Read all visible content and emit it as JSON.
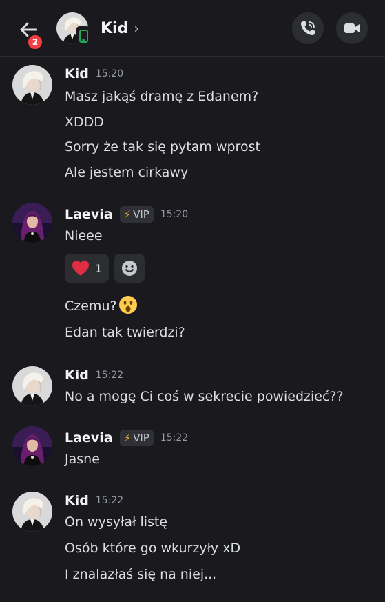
{
  "header": {
    "back_badge": "2",
    "title": "Kid",
    "chevron": "›",
    "icons": {
      "back": "arrow-left-icon",
      "call": "phone-call-icon",
      "video": "video-camera-icon",
      "status": "mobile-online-icon"
    }
  },
  "colors": {
    "background": "#1a1a1e",
    "badge": "#f23f43",
    "online": "#23a55a",
    "bolt": "#f0b232",
    "heart": "#dd2e44"
  },
  "messages": [
    {
      "author": "Kid",
      "time": "15:20",
      "lines": [
        "Masz jakąś dramę z Edanem?",
        "XDDD",
        "Sorry że tak się pytam wprost",
        "Ale jestem cirkawy"
      ]
    },
    {
      "author": "Laevia",
      "badge": "VIP",
      "time": "15:20",
      "lines": [
        "Nieee"
      ],
      "reactions": [
        {
          "emoji": "heart-emoji",
          "count": "1"
        }
      ],
      "followup": [
        "Czemu?",
        "Edan tak twierdzi?"
      ]
    },
    {
      "author": "Kid",
      "time": "15:22",
      "lines": [
        "No a mogę Ci coś w sekrecie powiedzieć??"
      ]
    },
    {
      "author": "Laevia",
      "badge": "VIP",
      "time": "15:22",
      "lines": [
        "Jasne"
      ]
    },
    {
      "author": "Kid",
      "time": "15:22",
      "lines": [
        "On wysyłał listę",
        "Osób które go wkurzyły xD",
        "I znalazłaś się na niej..."
      ]
    }
  ]
}
